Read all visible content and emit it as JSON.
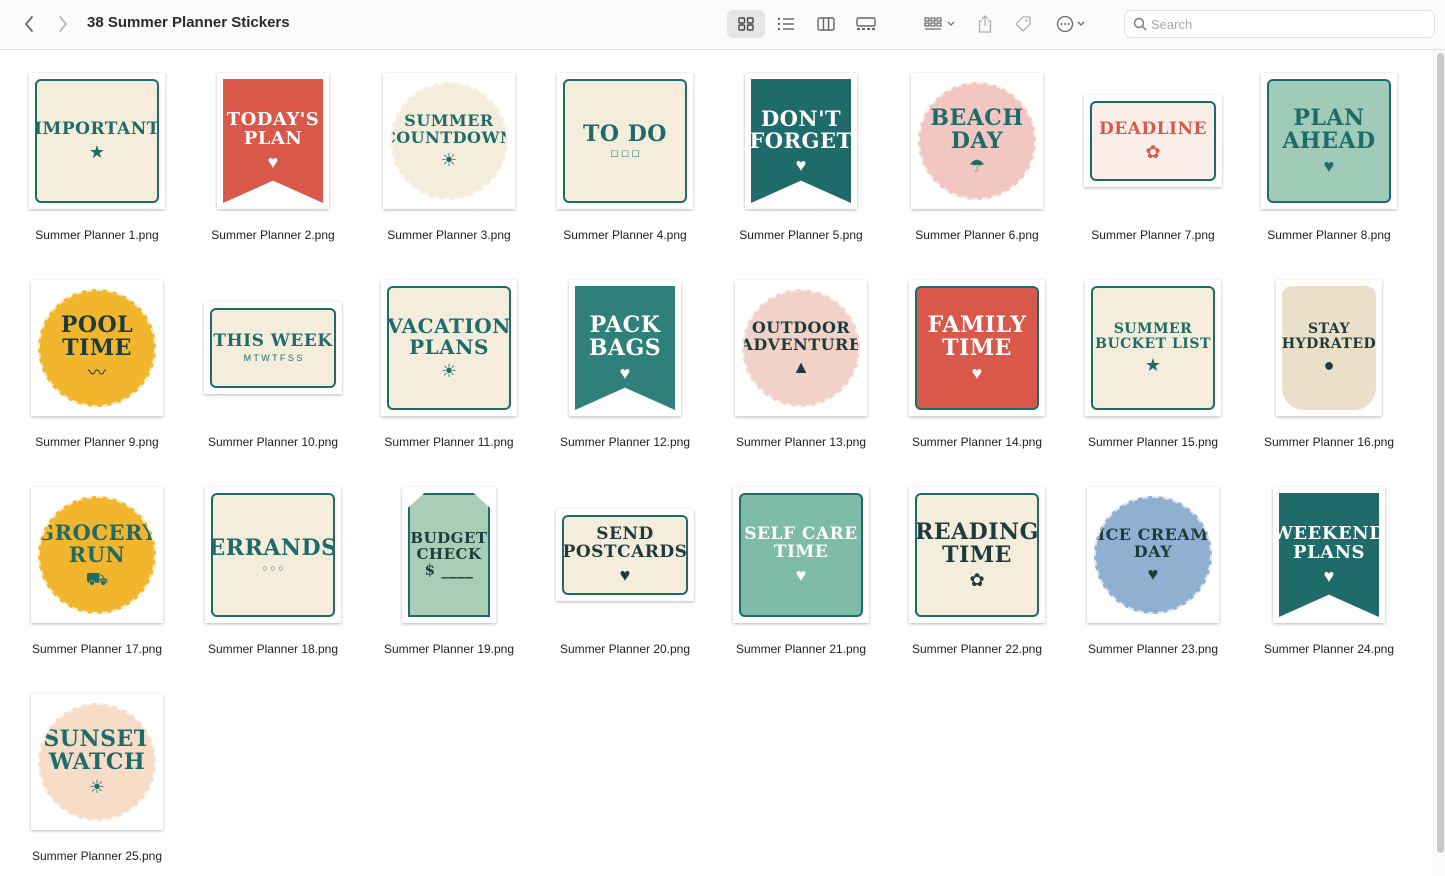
{
  "toolbar": {
    "title": "38 Summer Planner Stickers",
    "back_icon": "chevron-left-icon",
    "forward_icon": "chevron-right-icon",
    "search_placeholder": "Search"
  },
  "colors": {
    "teal": "#1e6b6a",
    "coral": "#d9584a",
    "cream": "#f5eddc",
    "yellow": "#f1b62e",
    "mint": "#9fcbb8",
    "pink": "#f2c7c2",
    "blue": "#8fb0d0"
  },
  "files": [
    {
      "name": "Summer Planner 1.png",
      "text": "IMPORTANT",
      "deco": "★",
      "shape": "square",
      "bg": "#f5eddc",
      "fg": "#1e6b6a"
    },
    {
      "name": "Summer Planner 2.png",
      "text": "TODAY'S\nPLAN",
      "deco": "♥",
      "shape": "banner",
      "bg": "#d9584a",
      "fg": "#ffffff"
    },
    {
      "name": "Summer Planner 3.png",
      "text": "SUMMER\nCOUNTDOWN",
      "deco": "☀",
      "shape": "circle",
      "bg": "#f5eddc",
      "fg": "#1e6b6a"
    },
    {
      "name": "Summer Planner 4.png",
      "text": "TO DO",
      "deco": "☐ ☐ ☐",
      "shape": "square",
      "bg": "#f5eddc",
      "fg": "#1e6b6a"
    },
    {
      "name": "Summer Planner 5.png",
      "text": "DON'T\nFORGET",
      "deco": "♥",
      "shape": "banner",
      "bg": "#1e6b6a",
      "fg": "#ffffff"
    },
    {
      "name": "Summer Planner 6.png",
      "text": "BEACH\nDAY",
      "deco": "☂",
      "shape": "circle",
      "bg": "#f2c7c2",
      "fg": "#1e6b6a"
    },
    {
      "name": "Summer Planner 7.png",
      "text": "DEADLINE",
      "deco": "✿",
      "shape": "wide",
      "bg": "#fbeee8",
      "fg": "#d9584a"
    },
    {
      "name": "Summer Planner 8.png",
      "text": "PLAN\nAHEAD",
      "deco": "♥",
      "shape": "square",
      "bg": "#9fcbb8",
      "fg": "#1e6b6a"
    },
    {
      "name": "Summer Planner 9.png",
      "text": "POOL\nTIME",
      "deco": "〰",
      "shape": "circle",
      "bg": "#f1b62e",
      "fg": "#1e3b3b"
    },
    {
      "name": "Summer Planner 10.png",
      "text": "THIS WEEK",
      "deco": "M T W T F S S",
      "shape": "wide",
      "bg": "#f5eddc",
      "fg": "#1e6b6a"
    },
    {
      "name": "Summer Planner 11.png",
      "text": "VACATION\nPLANS",
      "deco": "☀",
      "shape": "square",
      "bg": "#f5eddc",
      "fg": "#1e6b6a"
    },
    {
      "name": "Summer Planner 12.png",
      "text": "PACK\nBAGS",
      "deco": "♥",
      "shape": "banner",
      "bg": "#2f7f7a",
      "fg": "#ffffff"
    },
    {
      "name": "Summer Planner 13.png",
      "text": "OUTDOOR\nADVENTURE",
      "deco": "▲",
      "shape": "circle",
      "bg": "#f2d2c8",
      "fg": "#1e3b3b"
    },
    {
      "name": "Summer Planner 14.png",
      "text": "FAMILY\nTIME",
      "deco": "♥",
      "shape": "square",
      "bg": "#d9584a",
      "fg": "#ffffff"
    },
    {
      "name": "Summer Planner 15.png",
      "text": "SUMMER\nBUCKET LIST",
      "deco": "★",
      "shape": "square",
      "bg": "#f5eddc",
      "fg": "#1e6b6a"
    },
    {
      "name": "Summer Planner 16.png",
      "text": "STAY\nHYDRATED",
      "deco": "●",
      "shape": "cup",
      "bg": "#eadfc8",
      "fg": "#1e3b3b"
    },
    {
      "name": "Summer Planner 17.png",
      "text": "GROCERY\nRUN",
      "deco": "⛟",
      "shape": "circle",
      "bg": "#f1b62e",
      "fg": "#1e6b6a"
    },
    {
      "name": "Summer Planner 18.png",
      "text": "ERRANDS",
      "deco": "○ ○ ○",
      "shape": "square",
      "bg": "#f5eddc",
      "fg": "#1e6b6a"
    },
    {
      "name": "Summer Planner 19.png",
      "text": "BUDGET\nCHECK\n$ ____",
      "deco": "",
      "shape": "tag",
      "bg": "#a9cdb6",
      "fg": "#1e3b3b"
    },
    {
      "name": "Summer Planner 20.png",
      "text": "SEND\nPOSTCARDS",
      "deco": "♥",
      "shape": "wide",
      "bg": "#f5eddc",
      "fg": "#1e3b3b"
    },
    {
      "name": "Summer Planner 21.png",
      "text": "SELF CARE\nTIME",
      "deco": "♥",
      "shape": "square",
      "bg": "#7fbca7",
      "fg": "#ffffff"
    },
    {
      "name": "Summer Planner 22.png",
      "text": "READING\nTIME",
      "deco": "✿",
      "shape": "square",
      "bg": "#f5eddc",
      "fg": "#1e3b3b"
    },
    {
      "name": "Summer Planner 23.png",
      "text": "ICE CREAM\nDAY",
      "deco": "♥",
      "shape": "circle",
      "bg": "#8fb0d0",
      "fg": "#1e3b3b"
    },
    {
      "name": "Summer Planner 24.png",
      "text": "WEEKEND\nPLANS",
      "deco": "♥",
      "shape": "banner",
      "bg": "#1e6b6a",
      "fg": "#ffffff"
    },
    {
      "name": "Summer Planner 25.png",
      "text": "SUNSET\nWATCH",
      "deco": "☀",
      "shape": "circle",
      "bg": "#f7dcc8",
      "fg": "#1e6b6a"
    }
  ]
}
